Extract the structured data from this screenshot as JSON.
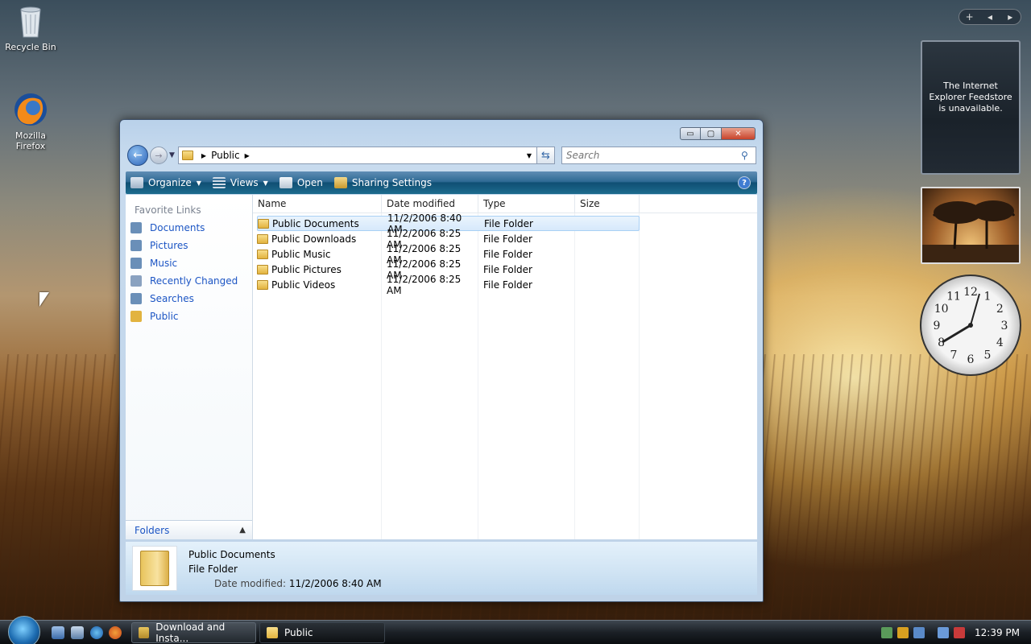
{
  "desktop": {
    "icons": [
      {
        "label": "Recycle Bin"
      },
      {
        "label": "Mozilla\nFirefox"
      }
    ]
  },
  "gadgets": {
    "sidebar_controls": {
      "add": "+",
      "prev": "◂",
      "next": "▸"
    },
    "feed_message": "The Internet Explorer Feedstore is unavailable.",
    "clock_numbers": [
      "12",
      "1",
      "2",
      "3",
      "4",
      "5",
      "6",
      "7",
      "8",
      "9",
      "10",
      "11"
    ]
  },
  "window": {
    "controls": {
      "minimize": "▭",
      "maximize": "▢",
      "close": "✕"
    },
    "address": {
      "path": [
        "Public"
      ]
    },
    "search": {
      "placeholder": "Search"
    },
    "toolbar": {
      "organize": "Organize",
      "views": "Views",
      "open": "Open",
      "sharing": "Sharing Settings",
      "help": "?"
    },
    "nav_pane": {
      "header": "Favorite Links",
      "items": [
        {
          "label": "Documents",
          "color": "#6a8fb8"
        },
        {
          "label": "Pictures",
          "color": "#6a8fb8"
        },
        {
          "label": "Music",
          "color": "#6a8fb8"
        },
        {
          "label": "Recently Changed",
          "color": "#8aa2c0"
        },
        {
          "label": "Searches",
          "color": "#6a8fb8"
        },
        {
          "label": "Public",
          "color": "#e2b33f"
        }
      ],
      "folders_label": "Folders"
    },
    "columns": {
      "name": "Name",
      "date": "Date modified",
      "type": "Type",
      "size": "Size"
    },
    "files": [
      {
        "name": "Public Documents",
        "date": "11/2/2006 8:40 AM",
        "type": "File Folder",
        "selected": true
      },
      {
        "name": "Public Downloads",
        "date": "11/2/2006 8:25 AM",
        "type": "File Folder"
      },
      {
        "name": "Public Music",
        "date": "11/2/2006 8:25 AM",
        "type": "File Folder"
      },
      {
        "name": "Public Pictures",
        "date": "11/2/2006 8:25 AM",
        "type": "File Folder"
      },
      {
        "name": "Public Videos",
        "date": "11/2/2006 8:25 AM",
        "type": "File Folder"
      }
    ],
    "details": {
      "name": "Public Documents",
      "type": "File Folder",
      "date_label": "Date modified:",
      "date_value": "11/2/2006 8:40 AM"
    }
  },
  "taskbar": {
    "tasks": [
      {
        "label": "Download and Insta..."
      },
      {
        "label": "Public"
      }
    ],
    "clock": "12:39 PM"
  }
}
